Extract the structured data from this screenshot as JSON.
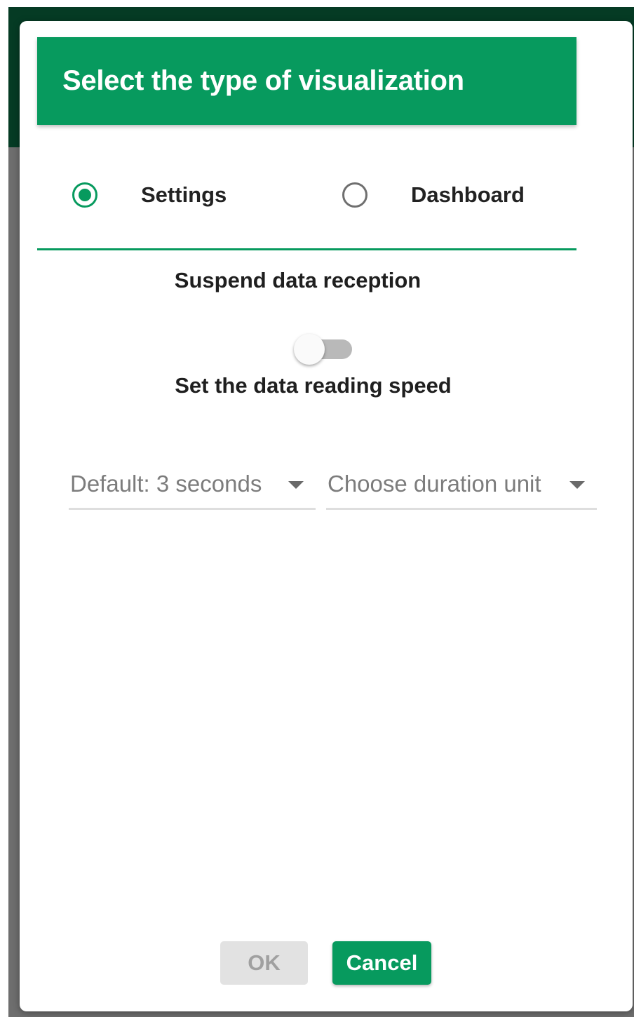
{
  "dialog": {
    "title": "Select the type of visualization"
  },
  "visualization_options": [
    {
      "label": "Settings",
      "selected": true
    },
    {
      "label": "Dashboard",
      "selected": false
    }
  ],
  "suspend": {
    "label": "Suspend data reception",
    "enabled": false
  },
  "speed": {
    "label": "Set the data reading speed",
    "value_select": "Default: 3 seconds",
    "unit_select": "Choose duration unit"
  },
  "buttons": {
    "ok": "OK",
    "cancel": "Cancel"
  },
  "colors": {
    "accent": "#079a5e",
    "header_dark": "#053b24",
    "backdrop": "#6e6e6e"
  }
}
